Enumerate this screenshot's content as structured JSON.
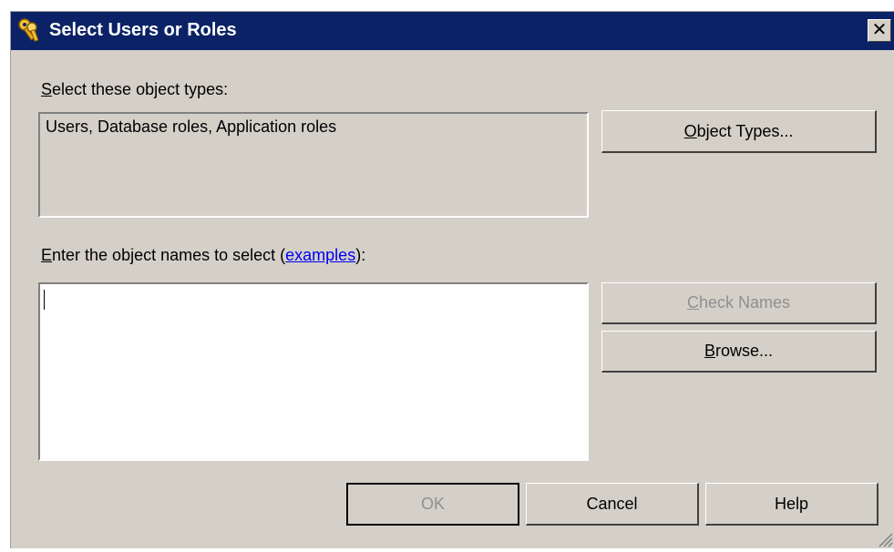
{
  "window": {
    "title": "Select Users or Roles",
    "close_label": "✕",
    "icon": "keys-icon",
    "titlebar_color": "#0b2266",
    "background_color": "#d4d0c8"
  },
  "object_types": {
    "label_accesskey": "S",
    "label_rest": "elect these object types:",
    "value": "Users, Database roles, Application roles",
    "button_accesskey": "O",
    "button_rest": "bject Types..."
  },
  "object_names": {
    "label_accesskey": "E",
    "label_rest": "nter the object names to select (",
    "link_text": "examples",
    "label_suffix": "):",
    "value": ""
  },
  "buttons": {
    "check_names_accesskey": "C",
    "check_names_rest": "heck Names",
    "browse_accesskey": "B",
    "browse_rest": "rowse...",
    "ok": "OK",
    "cancel": "Cancel",
    "help": "Help"
  }
}
